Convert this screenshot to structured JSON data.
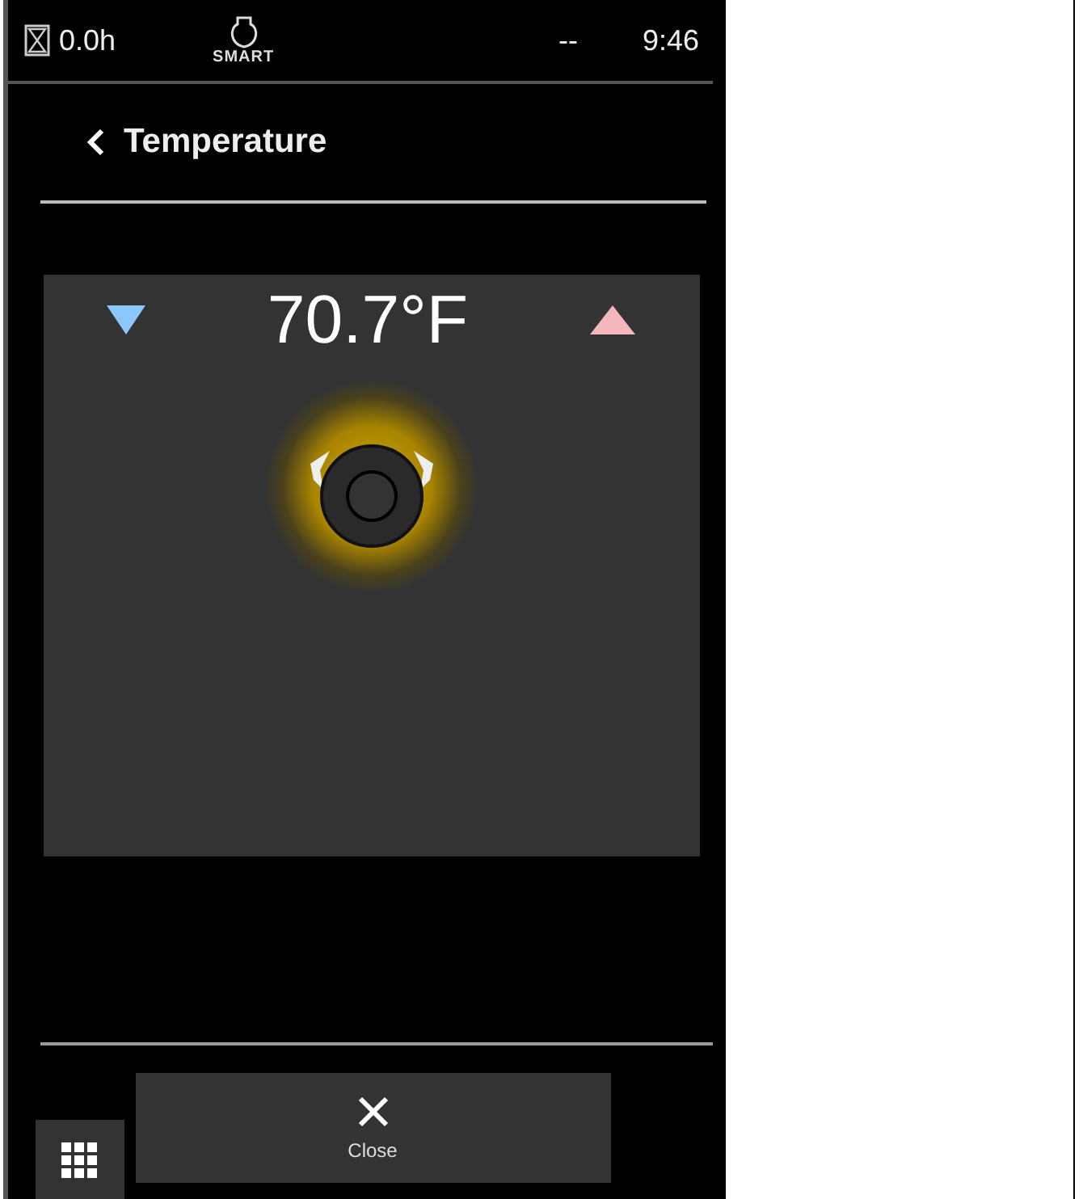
{
  "status_bar": {
    "timer": "0.0h",
    "mode": "SMART",
    "signal": "--",
    "time": "9:46"
  },
  "header": {
    "title": "Temperature"
  },
  "control": {
    "value": "70.7°F"
  },
  "footer": {
    "close_label": "Close"
  }
}
